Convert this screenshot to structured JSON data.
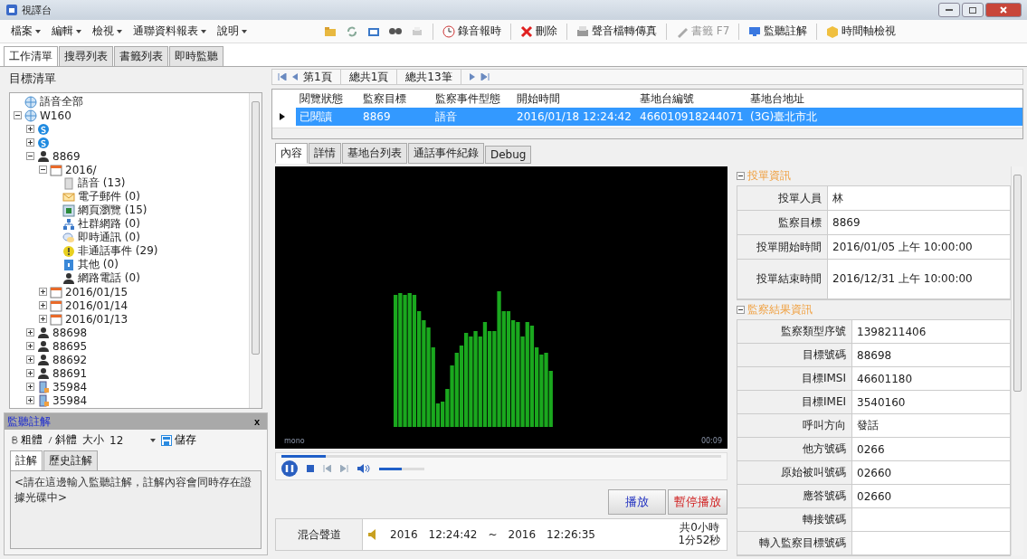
{
  "window": {
    "title": "視譯台"
  },
  "menu": [
    "檔案",
    "編輯",
    "檢視",
    "通聯資料報表",
    "說明"
  ],
  "toolbar": [
    {
      "kind": "icon"
    },
    {
      "kind": "icon"
    },
    {
      "kind": "icon"
    },
    {
      "kind": "icon"
    },
    {
      "kind": "icon"
    },
    {
      "kind": "button",
      "label": "錄音報時",
      "disabled": false
    },
    {
      "kind": "button",
      "label": "刪除",
      "disabled": false
    },
    {
      "kind": "button",
      "label": "聲音檔轉傳真",
      "disabled": false
    },
    {
      "kind": "button",
      "label": "書籤 F7",
      "disabled": true
    },
    {
      "kind": "button",
      "label": "監聽註解",
      "disabled": false
    },
    {
      "kind": "button",
      "label": "時間軸檢視",
      "disabled": false
    }
  ],
  "left_tabs": [
    {
      "label": "工作清單",
      "selected": true
    },
    {
      "label": "搜尋列表",
      "selected": false
    },
    {
      "label": "書籤列表",
      "selected": false
    },
    {
      "label": "即時監聽",
      "selected": false
    }
  ],
  "target_list": {
    "title": "目標清單",
    "tree": [
      {
        "kind": "globe",
        "label": "語音全部"
      },
      {
        "kind": "globe",
        "label": "W160",
        "expanded": true,
        "children": [
          {
            "kind": "skype",
            "expanded": false
          },
          {
            "kind": "skype",
            "expanded": false
          },
          {
            "kind": "person",
            "label": "8869",
            "expanded": true,
            "children": [
              {
                "kind": "date",
                "label": "2016/",
                "expanded": true,
                "children": [
                  {
                    "kind": "voice",
                    "label": "語音 (13)"
                  },
                  {
                    "kind": "email",
                    "label": "電子郵件 (0)"
                  },
                  {
                    "kind": "web",
                    "label": "網頁瀏覽 (15)"
                  },
                  {
                    "kind": "social",
                    "label": "社群網路 (0)"
                  },
                  {
                    "kind": "im",
                    "label": "即時通訊 (0)"
                  },
                  {
                    "kind": "event",
                    "label": "非通話事件 (29)"
                  },
                  {
                    "kind": "other",
                    "label": "其他 (0)"
                  },
                  {
                    "kind": "voip",
                    "label": "網路電話 (0)"
                  }
                ]
              },
              {
                "kind": "date",
                "label": "2016/01/15",
                "expanded": false
              },
              {
                "kind": "date",
                "label": "2016/01/14",
                "expanded": false
              },
              {
                "kind": "date",
                "label": "2016/01/13",
                "expanded": false
              }
            ]
          },
          {
            "kind": "person",
            "label": "88698",
            "expanded": false
          },
          {
            "kind": "person",
            "label": "88695",
            "expanded": false
          },
          {
            "kind": "person",
            "label": "88692",
            "expanded": false
          },
          {
            "kind": "person",
            "label": "88691",
            "expanded": false
          },
          {
            "kind": "phone",
            "label": "35984",
            "expanded": false
          },
          {
            "kind": "phone",
            "label": "35984",
            "expanded": false
          }
        ]
      }
    ]
  },
  "annotation": {
    "title": "監聽註解",
    "close": "x",
    "bold": "粗體",
    "italic": "斜體",
    "size_label": "大小",
    "size": "12",
    "save": "儲存",
    "tabs": [
      {
        "label": "註解",
        "selected": true
      },
      {
        "label": "歷史註解",
        "selected": false
      }
    ],
    "placeholder": "<請在這邊輸入監聽註解，註解內容會同時存在證據光碟中>"
  },
  "pager": {
    "page": "第1頁",
    "total_pages": "總共1頁",
    "total_records": "總共13筆"
  },
  "table": {
    "columns": [
      "閱覽狀態",
      "監察目標",
      "監察事件型態",
      "開始時間",
      "基地台編號",
      "基地台地址"
    ],
    "rows": [
      {
        "selected": true,
        "cells": [
          "已閱讀",
          "8869",
          "語音",
          "2016/01/18 12:24:42",
          "466010918244071",
          "(3G)臺北市北"
        ]
      }
    ]
  },
  "detail_tabs": [
    {
      "label": "內容",
      "selected": true
    },
    {
      "label": "詳情",
      "selected": false
    },
    {
      "label": "基地台列表",
      "selected": false
    },
    {
      "label": "通話事件紀錄",
      "selected": false
    },
    {
      "label": "Debug",
      "selected": false
    }
  ],
  "player": {
    "channel_mode": "mono",
    "time": "00:09",
    "seek": {
      "level": 0.1
    },
    "volume": {
      "level": 0.5
    },
    "playing": true
  },
  "buttons": [
    {
      "kind": "play",
      "label": "播放"
    },
    {
      "kind": "pause",
      "label": "暫停播放"
    }
  ],
  "call_row": {
    "channel": "混合聲道",
    "start": "2016",
    "start_time": "12:24:42",
    "separator": "~",
    "end": "2016",
    "end_time": "12:26:35",
    "duration": "共0小時1分52秒"
  },
  "info_sections": [
    {
      "title": "投單資訊",
      "expanded": true,
      "rows": [
        [
          "投單人員",
          "林"
        ],
        [
          "監察目標",
          "8869"
        ],
        [
          "投單開始時間",
          "2016/01/05 上午 10:00:00"
        ],
        [
          "投單結束時間",
          "2016/12/31 上午 10:00:00"
        ]
      ]
    },
    {
      "title": "監察結果資訊",
      "expanded": true,
      "rows": [
        [
          "監察類型序號",
          "1398211406"
        ],
        [
          "目標號碼",
          "88698"
        ],
        [
          "目標IMSI",
          "46601180"
        ],
        [
          "目標IMEI",
          "3540160"
        ],
        [
          "呼叫方向",
          "發話"
        ],
        [
          "他方號碼",
          "0266"
        ],
        [
          "原始被叫號碼",
          "02660"
        ],
        [
          "應答號碼",
          "02660"
        ],
        [
          "轉接號碼"
        ],
        [
          "轉入監察目標號碼"
        ]
      ]
    }
  ]
}
